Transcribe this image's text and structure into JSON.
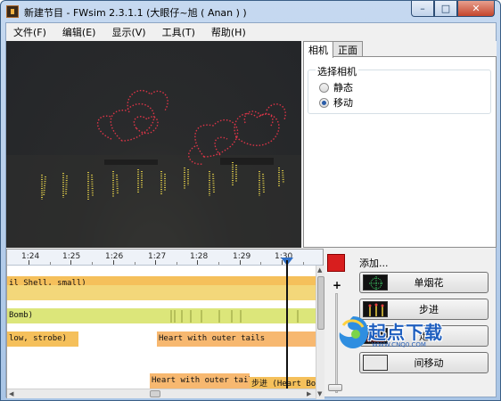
{
  "window": {
    "title": "新建节目 - FWsim 2.3.1.1 (大眼仔~旭 ( Anan ) )",
    "controls": {
      "minimize": "–",
      "maximize": "□",
      "close": "✕"
    }
  },
  "menu": {
    "items": [
      {
        "label": "文件(F)"
      },
      {
        "label": "编辑(E)"
      },
      {
        "label": "显示(V)"
      },
      {
        "label": "工具(T)"
      },
      {
        "label": "帮助(H)"
      }
    ]
  },
  "side_panel": {
    "tabs": [
      {
        "label": "相机",
        "active": true
      },
      {
        "label": "正面",
        "active": false
      }
    ],
    "camera_group": {
      "label": "选择相机",
      "options": [
        {
          "label": "静态",
          "selected": false
        },
        {
          "label": "移动",
          "selected": true
        }
      ]
    }
  },
  "timeline": {
    "ticks": [
      "1:24",
      "1:25",
      "1:26",
      "1:27",
      "1:28",
      "1:29",
      "1:30"
    ],
    "tracks": [
      {
        "text": "il Shell, small)",
        "color": "#f5c05b"
      },
      {
        "text": "",
        "color": "#f3d77a"
      },
      {
        "text": "Bomb)",
        "color": "#dce67a"
      },
      {
        "text": "low, strobe)",
        "color": "#f5c05b"
      },
      {
        "text": "Heart with outer tails",
        "color": "#f7b870"
      },
      {
        "text": "Heart with outer tails",
        "color": "#f7b870"
      },
      {
        "text": "步进 (Heart Bo",
        "color": "#f5c05b"
      }
    ]
  },
  "zoom": {
    "plus": "+",
    "minus": "–",
    "current_color": "#d81e1e"
  },
  "add_panel": {
    "label": "添加...",
    "buttons": [
      {
        "label": "单烟花",
        "icon": "single-firework-icon"
      },
      {
        "label": "步进",
        "icon": "step-icon"
      },
      {
        "label": "炮台",
        "icon": "battery-icon"
      },
      {
        "label": "间移动",
        "icon": "move-icon"
      }
    ]
  },
  "watermark": {
    "text": "起点下载",
    "sub": "WWW.CNQ0.COM"
  }
}
